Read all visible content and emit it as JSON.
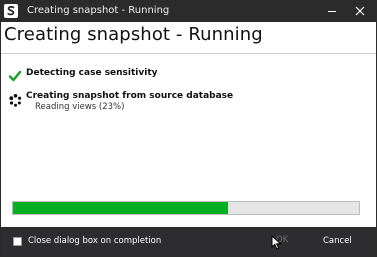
{
  "window": {
    "title": "Creating snapshot - Running",
    "app_icon": "snapshot-app-icon"
  },
  "titlebar_buttons": {
    "minimize_icon": "minimize-icon",
    "close_icon": "close-icon"
  },
  "heading": "Creating snapshot - Running",
  "steps": [
    {
      "label": "Detecting case sensitivity",
      "status": "complete",
      "icon": "check-icon"
    },
    {
      "label": "Creating snapshot from source database",
      "detail": "Reading views (23%)",
      "status": "in-progress",
      "icon": "spinner-icon"
    }
  ],
  "progress": {
    "fraction": 0.62,
    "fill_color": "#06b025"
  },
  "footer": {
    "close_on_completion_label": "Close dialog box on completion",
    "close_on_completion_checked": false,
    "ok_label": "OK",
    "cancel_label": "Cancel"
  }
}
